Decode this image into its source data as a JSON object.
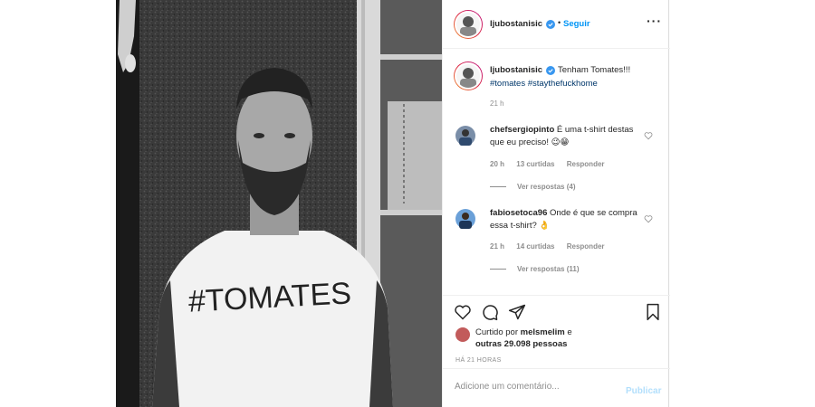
{
  "post": {
    "username": "ljubostanisic",
    "follow_label": "Seguir",
    "more_label": "···",
    "shirt_text": "#TOMATES",
    "caption_text": "Tenham Tomates!!!",
    "caption_tags": "#tomates #staythefuckhome",
    "caption_time": "21 h"
  },
  "comments": [
    {
      "user": "chefsergiopinto",
      "text": "É uma t-shirt destas que eu preciso! 😉😁",
      "time": "20 h",
      "likes": "13 curtidas",
      "reply": "Responder",
      "view_replies": "Ver respostas (4)"
    },
    {
      "user": "fabiosetoca96",
      "text": "Onde é que se compra essa t-shirt? 👌",
      "time": "21 h",
      "likes": "14 curtidas",
      "reply": "Responder",
      "view_replies": "Ver respostas (11)"
    }
  ],
  "actions": {
    "liked_prefix": "Curtido por",
    "liked_user": "melsmelim",
    "liked_connector": "e",
    "liked_others": "outras 29.098 pessoas",
    "timestamp": "HÁ 21 HORAS"
  },
  "comment_box": {
    "placeholder": "Adicione um comentário...",
    "publish_label": "Publicar"
  },
  "icons": {
    "verified": "verified-badge-icon",
    "like": "heart-icon",
    "comment": "comment-bubble-icon",
    "share": "paper-plane-icon",
    "save": "bookmark-icon",
    "more": "more-options-icon"
  },
  "colors": {
    "accent": "#0095f6",
    "text": "#262626",
    "muted": "#8e8e8e",
    "tag": "#00376b"
  }
}
